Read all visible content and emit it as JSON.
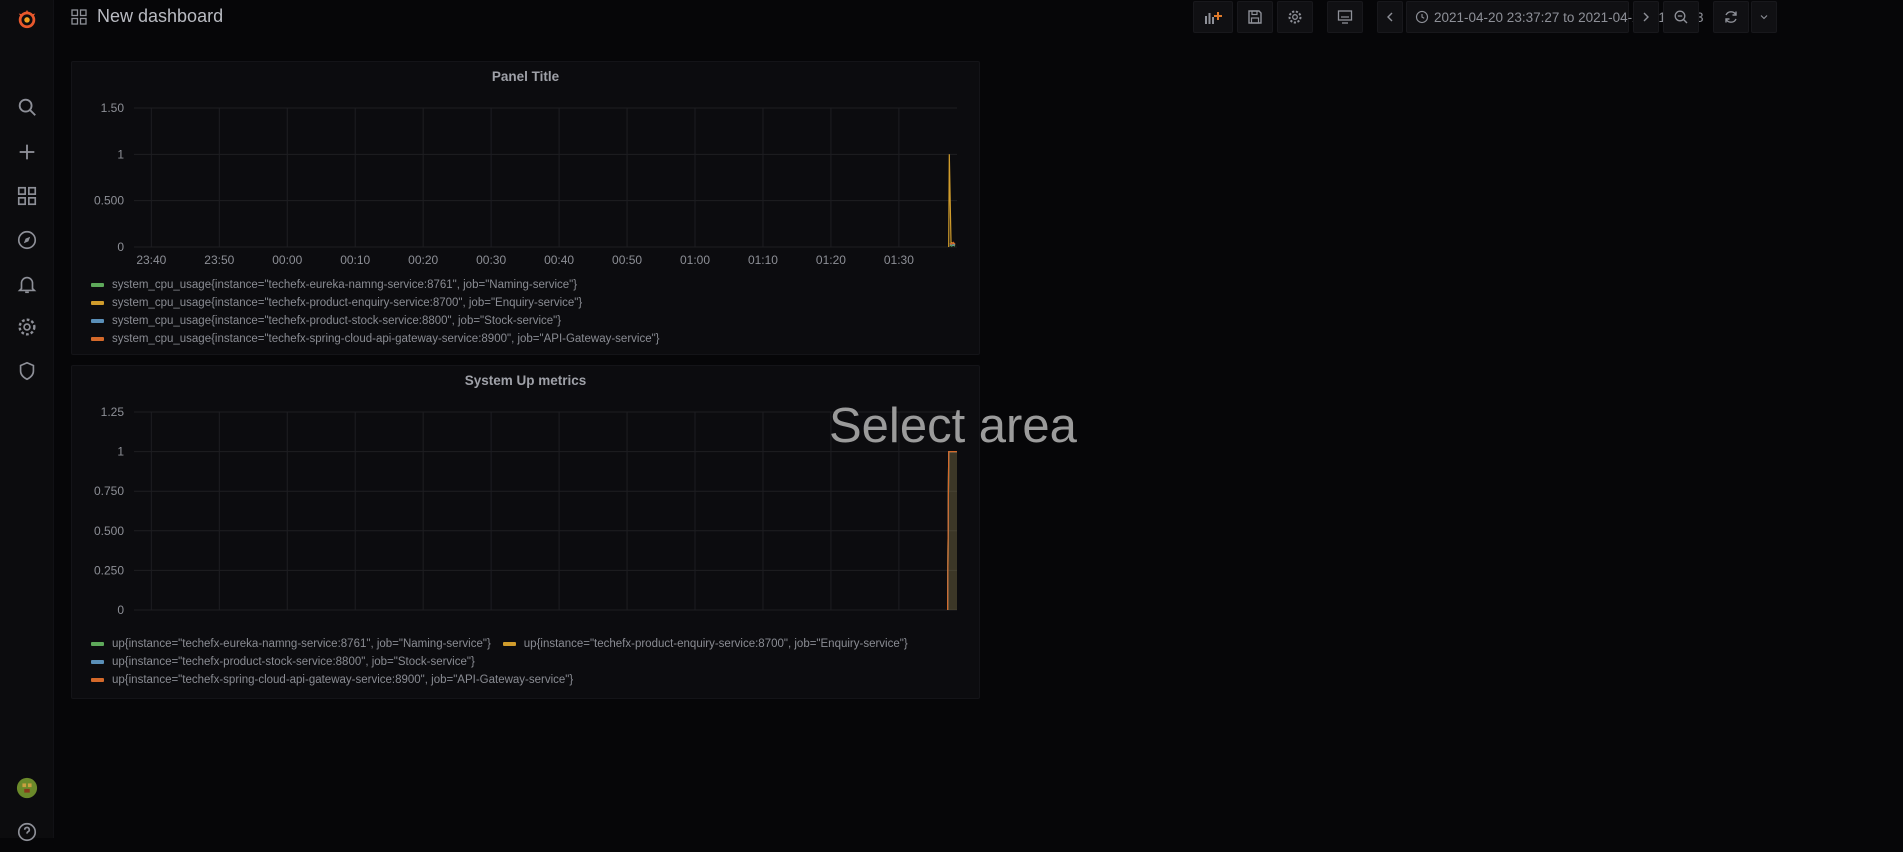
{
  "app": {
    "name": "Grafana"
  },
  "topbar": {
    "title": "New dashboard",
    "time_range": "2021-04-20 23:37:27 to 2021-04-21 01:38:33"
  },
  "sidebar": {
    "items": [
      {
        "name": "search",
        "icon": "search-icon"
      },
      {
        "name": "create",
        "icon": "plus-icon"
      },
      {
        "name": "dashboards",
        "icon": "dashboards-grid-icon"
      },
      {
        "name": "explore",
        "icon": "compass-icon"
      },
      {
        "name": "alerting",
        "icon": "bell-icon"
      },
      {
        "name": "configuration",
        "icon": "gear-icon"
      },
      {
        "name": "server-admin",
        "icon": "shield-icon"
      }
    ]
  },
  "overlay": {
    "text": "Select area"
  },
  "colors": {
    "green": "#5ea95a",
    "yellow": "#d09c2c",
    "blue": "#5a8fb8",
    "orange": "#d4692a",
    "grid": "#1e1e22"
  },
  "x_ticks": [
    "23:40",
    "23:50",
    "00:00",
    "00:10",
    "00:20",
    "00:30",
    "00:40",
    "00:50",
    "01:00",
    "01:10",
    "01:20",
    "01:30"
  ],
  "chart_data": [
    {
      "type": "line",
      "title": "Panel Title",
      "y_ticks": [
        "1.50",
        "1",
        "0.500",
        "0"
      ],
      "ylim": [
        0,
        1.5
      ],
      "xlim": [
        "23:37:27",
        "01:38:33"
      ],
      "series": [
        {
          "name": "system_cpu_usage{instance=\"techefx-eureka-namng-service:8761\", job=\"Naming-service\"}",
          "color": "#5ea95a",
          "points": [
            [
              "01:37:30",
              0.02
            ],
            [
              "01:37:45",
              0.01
            ],
            [
              "01:38:00",
              0.02
            ],
            [
              "01:38:15",
              0.01
            ]
          ]
        },
        {
          "name": "system_cpu_usage{instance=\"techefx-product-enquiry-service:8700\", job=\"Enquiry-service\"}",
          "color": "#d09c2c",
          "points": [
            [
              "01:37:20",
              0
            ],
            [
              "01:37:25",
              1.0
            ],
            [
              "01:37:40",
              0.05
            ],
            [
              "01:38:00",
              0.04
            ],
            [
              "01:38:15",
              0.02
            ]
          ]
        },
        {
          "name": "system_cpu_usage{instance=\"techefx-product-stock-service:8800\", job=\"Stock-service\"}",
          "color": "#5a8fb8",
          "points": [
            [
              "01:37:30",
              0.03
            ],
            [
              "01:38:00",
              0.02
            ],
            [
              "01:38:15",
              0.03
            ]
          ]
        },
        {
          "name": "system_cpu_usage{instance=\"techefx-spring-cloud-api-gateway-service:8900\", job=\"API-Gateway-service\"}",
          "color": "#d4692a",
          "points": [
            [
              "01:37:30",
              0.04
            ],
            [
              "01:37:45",
              0.03
            ],
            [
              "01:38:00",
              0.05
            ],
            [
              "01:38:15",
              0.03
            ]
          ]
        }
      ]
    },
    {
      "type": "area",
      "title": "System Up metrics",
      "y_ticks": [
        "1.25",
        "1",
        "0.750",
        "0.500",
        "0.250",
        "0"
      ],
      "ylim": [
        0,
        1.25
      ],
      "xlim": [
        "23:37:27",
        "01:38:33"
      ],
      "series": [
        {
          "name": "up{instance=\"techefx-eureka-namng-service:8761\", job=\"Naming-service\"}",
          "color": "#5ea95a",
          "points": [
            [
              "01:37:10",
              0
            ],
            [
              "01:37:20",
              1
            ],
            [
              "01:38:33",
              1
            ]
          ]
        },
        {
          "name": "up{instance=\"techefx-product-enquiry-service:8700\", job=\"Enquiry-service\"}",
          "color": "#d09c2c",
          "points": [
            [
              "01:37:10",
              0
            ],
            [
              "01:37:20",
              1
            ],
            [
              "01:38:33",
              1
            ]
          ]
        },
        {
          "name": "up{instance=\"techefx-product-stock-service:8800\", job=\"Stock-service\"}",
          "color": "#5a8fb8",
          "points": [
            [
              "01:37:10",
              0
            ],
            [
              "01:37:20",
              1
            ],
            [
              "01:38:33",
              1
            ]
          ]
        },
        {
          "name": "up{instance=\"techefx-spring-cloud-api-gateway-service:8900\", job=\"API-Gateway-service\"}",
          "color": "#d4692a",
          "points": [
            [
              "01:37:10",
              0
            ],
            [
              "01:37:20",
              1
            ],
            [
              "01:38:33",
              1
            ]
          ]
        }
      ]
    }
  ]
}
